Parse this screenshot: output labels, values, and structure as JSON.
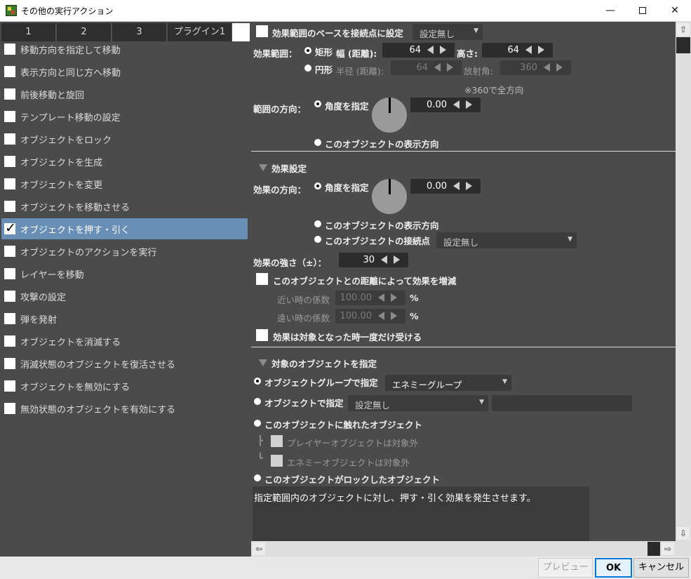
{
  "window": {
    "title": "その他の実行アクション",
    "min": "—",
    "close": "✕"
  },
  "tabs": [
    "1",
    "2",
    "3",
    "プラグイン1"
  ],
  "actions": [
    {
      "label": "移動方向を指定して移動",
      "checked": false
    },
    {
      "label": "表示方向と同じ方へ移動",
      "checked": false
    },
    {
      "label": "前後移動と旋回",
      "checked": false
    },
    {
      "label": "テンプレート移動の設定",
      "checked": false
    },
    {
      "label": "オブジェクトをロック",
      "checked": false
    },
    {
      "label": "オブジェクトを生成",
      "checked": false
    },
    {
      "label": "オブジェクトを変更",
      "checked": false
    },
    {
      "label": "オブジェクトを移動させる",
      "checked": false
    },
    {
      "label": "オブジェクトを押す・引く",
      "checked": true
    },
    {
      "label": "オブジェクトのアクションを実行",
      "checked": false
    },
    {
      "label": "レイヤーを移動",
      "checked": false
    },
    {
      "label": "攻撃の設定",
      "checked": false
    },
    {
      "label": "弾を発射",
      "checked": false
    },
    {
      "label": "オブジェクトを消滅する",
      "checked": false
    },
    {
      "label": "消滅状態のオブジェクトを復活させる",
      "checked": false
    },
    {
      "label": "オブジェクトを無効にする",
      "checked": false
    },
    {
      "label": "無効状態のオブジェクトを有効にする",
      "checked": false
    }
  ],
  "area": {
    "base_label": "効果範囲のベースを接続点に設定",
    "base_dropdown": "設定無し",
    "range_label": "効果範囲：",
    "rect_label": "矩形",
    "width_label": "幅 (距離):",
    "width_value": "64",
    "height_label": "高さ:",
    "height_value": "64",
    "circle_label": "円形",
    "radius_label": "半径 (距離):",
    "radius_value": "64",
    "angle_label": "放射角:",
    "angle_value": "360",
    "note": "※360で全方向",
    "dir_label": "範囲の方向：",
    "dir_angle_label": "角度を指定",
    "dir_angle_value": "0.00",
    "dir_display_label": "このオブジェクトの表示方向"
  },
  "effect": {
    "section_title": "効果設定",
    "dir_label": "効果の方向：",
    "angle_label": "角度を指定",
    "angle_value": "0.00",
    "display_label": "このオブジェクトの表示方向",
    "connect_label": "このオブジェクトの接続点",
    "connect_dropdown": "設定無し",
    "strength_label": "効果の強さ（±）：",
    "strength_value": "30",
    "distance_label": "このオブジェクトとの距離によって効果を増減",
    "near_label": "近い時の係数",
    "near_value": "100.00",
    "far_label": "遠い時の係数",
    "far_value": "100.00",
    "percent": "%",
    "once_label": "効果は対象となった時一度だけ受ける"
  },
  "target": {
    "section_title": "対象のオブジェクトを指定",
    "group_label": "オブジェクトグループで指定",
    "group_dropdown": "エネミーグループ",
    "object_label": "オブジェクトで指定",
    "object_dropdown": "設定無し",
    "touched_label": "このオブジェクトに触れたオブジェクト",
    "player_excl": "プレイヤーオブジェクトは対象外",
    "enemy_excl": "エネミーオブジェクトは対象外",
    "locked_label": "このオブジェクトがロックしたオブジェクト"
  },
  "description": "指定範囲内のオブジェクトに対し、押す・引く効果を発生させます。",
  "buttons": {
    "preview": "プレビュー",
    "ok": "OK",
    "cancel": "キャンセル"
  },
  "colors": {
    "panel": "#4b4b4b",
    "selected": "#6a8fb6",
    "accent": "#0078d7"
  }
}
